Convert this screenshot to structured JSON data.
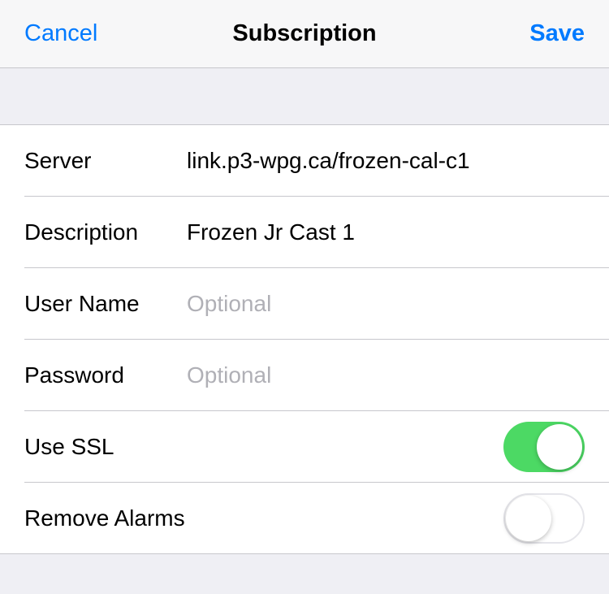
{
  "nav": {
    "cancel": "Cancel",
    "title": "Subscription",
    "save": "Save"
  },
  "form": {
    "server_label": "Server",
    "server_value": "link.p3-wpg.ca/frozen-cal-c1",
    "description_label": "Description",
    "description_value": "Frozen Jr Cast 1",
    "username_label": "User Name",
    "username_value": "",
    "username_placeholder": "Optional",
    "password_label": "Password",
    "password_value": "",
    "password_placeholder": "Optional",
    "use_ssl_label": "Use SSL",
    "use_ssl_on": true,
    "remove_alarms_label": "Remove Alarms",
    "remove_alarms_on": false
  }
}
